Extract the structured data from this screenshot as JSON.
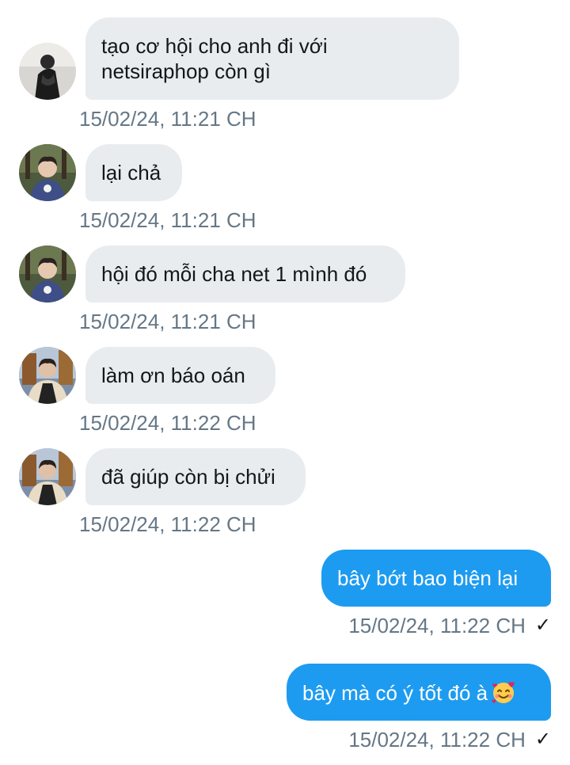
{
  "messages": [
    {
      "text": "tạo cơ hội cho anh đi với\nnetsiraphop còn gì",
      "time": "15/02/24, 11:21 CH"
    },
    {
      "text": "lại chả",
      "time": "15/02/24, 11:21 CH"
    },
    {
      "text": "hội đó mỗi cha net 1 mình đó",
      "time": "15/02/24, 11:21 CH"
    },
    {
      "text": "làm ơn báo oán",
      "time": "15/02/24, 11:22 CH"
    },
    {
      "text": "đã giúp còn bị chửi",
      "time": "15/02/24, 11:22 CH"
    },
    {
      "text": "bây bớt bao biện lại",
      "time": "15/02/24, 11:22 CH",
      "status": "✓"
    },
    {
      "text": "bây mà có ý tốt đó à",
      "time": "15/02/24, 11:22 CH",
      "status": "✓",
      "emoji": "smiling-face-with-hearts-icon"
    }
  ],
  "colors": {
    "incoming_bubble": "#e9ecef",
    "outgoing_bubble": "#1d9bf0",
    "timestamp": "#657786"
  }
}
